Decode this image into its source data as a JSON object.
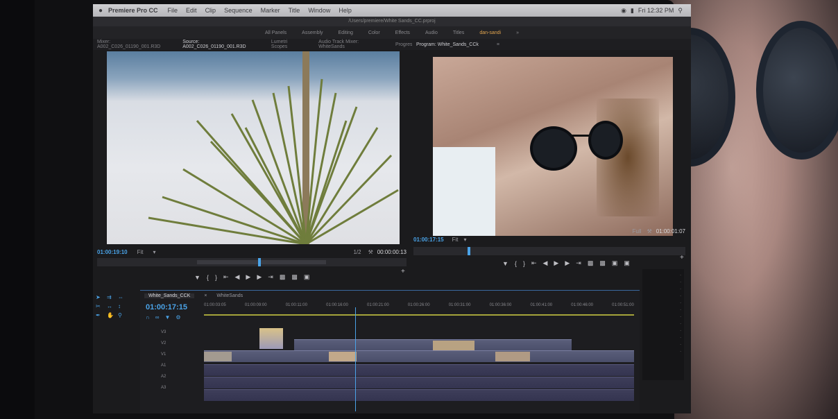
{
  "menubar": {
    "app_name": "Premiere Pro CC",
    "items": [
      "File",
      "Edit",
      "Clip",
      "Sequence",
      "Marker",
      "Title",
      "Window",
      "Help"
    ],
    "status_right": "Fri 12:32 PM"
  },
  "window_title": "/Users/premiere/White Sands_CC.prproj",
  "workspaces": {
    "items": [
      "All Panels",
      "Assembly",
      "Editing",
      "Color",
      "Effects",
      "Audio",
      "Titles"
    ],
    "active": "dan-sandi"
  },
  "source_panel": {
    "tabs": [
      "Source: A002_C026_01190_001.R3D",
      "Lumetri Scopes",
      "Audio Track Mixer: WhiteSands",
      "Progress"
    ],
    "left_clip_label": "Mixer: A002_C026_01190_001.R3D",
    "timecode_in": "01:00:19:10",
    "fit": "Fit",
    "resolution": "1/2",
    "duration": "00:00:00:13"
  },
  "program_panel": {
    "tab": "Program: White_Sands_CCk",
    "timecode": "01:00:17:15",
    "fit": "Fit",
    "resolution": "Full",
    "duration": "01:00:01:07"
  },
  "timeline": {
    "tabs": [
      "White_Sands_CCK",
      "WhiteSands"
    ],
    "timecode": "01:00:17:15",
    "ruler": [
      "01:00:03:05",
      "01:00:09:00",
      "01:00:11:00",
      "01:00:16:00",
      "01:00:21:00",
      "01:00:26:00",
      "01:00:31:00",
      "01:00:36:00",
      "01:00:41:00",
      "01:00:46:00",
      "01:00:51:00"
    ],
    "tracks": [
      "V3",
      "V2",
      "V1",
      "A1",
      "A2",
      "A3"
    ]
  },
  "colors": {
    "accent_blue": "#4aa3e8",
    "workspace_active": "#e2a54e",
    "work_area": "#a6a43a"
  }
}
